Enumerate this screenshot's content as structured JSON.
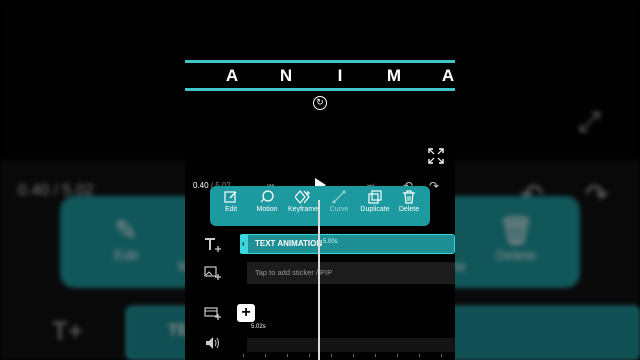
{
  "background_ui": {
    "time_current": "0.40",
    "time_total": "5.02",
    "edit_label": "Edit",
    "partial_label_m": "M",
    "partial_label_te": "te",
    "delete_label": "Delete",
    "text_clip_partial": "TE"
  },
  "preview": {
    "animated_letters": [
      "A",
      "N",
      "I",
      "M",
      "A"
    ],
    "accent_color": "#3fc4c8"
  },
  "player": {
    "time_current": "0.40",
    "time_separator": " / ",
    "time_total": "5.02"
  },
  "toolbar": {
    "items": [
      {
        "label": "Edit",
        "icon": "edit-icon"
      },
      {
        "label": "Motion",
        "icon": "motion-icon"
      },
      {
        "label": "Keyframe",
        "icon": "keyframe-icon"
      },
      {
        "label": "Curve",
        "icon": "curve-icon",
        "disabled": true
      },
      {
        "label": "Duplicate",
        "icon": "duplicate-icon"
      },
      {
        "label": "Delete",
        "icon": "delete-icon"
      }
    ],
    "color": "#1c9aa0"
  },
  "timeline": {
    "text_clip_name": "TEXT ANIMATION",
    "text_clip_duration": "5.00s",
    "sticker_hint": "Tap to add sticker / PIP",
    "video_clip_duration": "5.02s",
    "add_label": "+"
  }
}
